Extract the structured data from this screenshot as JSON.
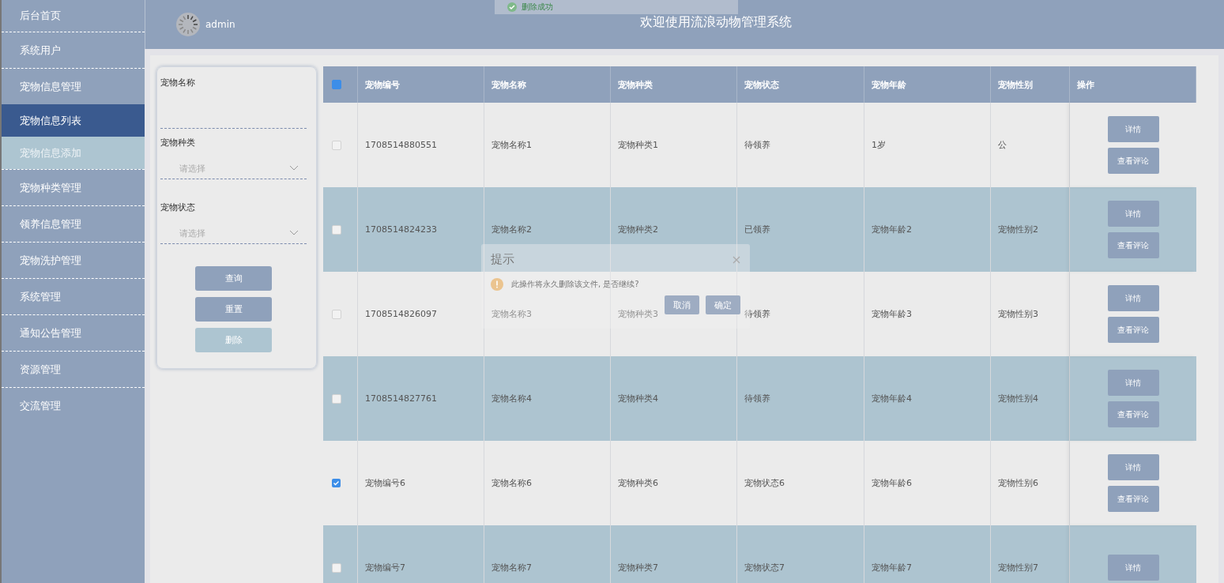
{
  "sidebar": {
    "items": [
      {
        "label": "后台首页",
        "selected": false
      },
      {
        "label": "系统用户",
        "selected": false
      },
      {
        "label": "宠物信息管理",
        "selected": false,
        "children": [
          {
            "label": "宠物信息列表",
            "selected": true
          },
          {
            "label": "宠物信息添加",
            "selected": false
          }
        ]
      },
      {
        "label": "宠物种类管理",
        "selected": false
      },
      {
        "label": "领养信息管理",
        "selected": false
      },
      {
        "label": "宠物洗护管理",
        "selected": false
      },
      {
        "label": "系统管理",
        "selected": false
      },
      {
        "label": "通知公告管理",
        "selected": false
      },
      {
        "label": "资源管理",
        "selected": false
      },
      {
        "label": "交流管理",
        "selected": false
      }
    ]
  },
  "header": {
    "user": "admin",
    "title": "欢迎使用流浪动物管理系统"
  },
  "toast": {
    "message": "删除成功"
  },
  "search": {
    "fields": [
      {
        "kind": "text",
        "label": "宠物名称"
      },
      {
        "kind": "select",
        "label": "宠物种类",
        "placeholder": "请选择"
      },
      {
        "kind": "select",
        "label": "宠物状态",
        "placeholder": "请选择"
      }
    ],
    "buttons": [
      {
        "label": "查询",
        "disabled": false
      },
      {
        "label": "重置",
        "disabled": false
      },
      {
        "label": "删除",
        "disabled": true
      }
    ]
  },
  "table": {
    "select_all": {
      "checked": true
    },
    "columns": [
      "宠物编号",
      "宠物名称",
      "宠物种类",
      "宠物状态",
      "宠物年龄",
      "宠物性别",
      "操作"
    ],
    "rows": [
      {
        "checked": false,
        "cells": [
          "1708514880551",
          "宠物名称1",
          "宠物种类1",
          "待领养",
          "1岁",
          "公"
        ],
        "actions": [
          "详情",
          "查看评论"
        ]
      },
      {
        "checked": false,
        "cells": [
          "1708514824233",
          "宠物名称2",
          "宠物种类2",
          "已领养",
          "宠物年龄2",
          "宠物性别2"
        ],
        "actions": [
          "详情",
          "查看评论"
        ]
      },
      {
        "checked": false,
        "cells": [
          "1708514826097",
          "宠物名称3",
          "宠物种类3",
          "待领养",
          "宠物年龄3",
          "宠物性别3"
        ],
        "actions": [
          "详情",
          "查看评论"
        ]
      },
      {
        "checked": false,
        "cells": [
          "1708514827761",
          "宠物名称4",
          "宠物种类4",
          "待领养",
          "宠物年龄4",
          "宠物性别4"
        ],
        "actions": [
          "详情",
          "查看评论"
        ]
      },
      {
        "checked": true,
        "cells": [
          "宠物编号6",
          "宠物名称6",
          "宠物种类6",
          "宠物状态6",
          "宠物年龄6",
          "宠物性别6"
        ],
        "actions": [
          "详情",
          "查看评论"
        ]
      },
      {
        "checked": false,
        "cells": [
          "宠物编号7",
          "宠物名称7",
          "宠物种类7",
          "宠物状态7",
          "宠物年龄7",
          "宠物性别7"
        ],
        "actions": [
          "详情"
        ]
      }
    ]
  },
  "dialog": {
    "title": "提示",
    "message": "此操作将永久删除该文件, 是否继续?",
    "buttons": [
      "取消",
      "确定"
    ]
  }
}
